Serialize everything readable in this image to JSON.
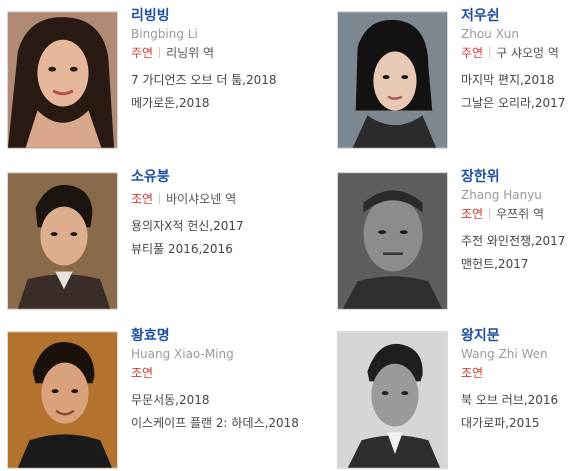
{
  "actors": [
    {
      "name": "리빙빙",
      "en_name": "Bingbing Li",
      "role": "주연",
      "character": "리닝위 역",
      "works": [
        "7 가디언즈 오브 더 툼,2018",
        "메가로돈,2018"
      ]
    },
    {
      "name": "저우쉰",
      "en_name": "Zhou Xun",
      "role": "주연",
      "character": "구 샤오멍 역",
      "works": [
        "마지막 편지,2018",
        "그날은 오리라,2017"
      ]
    },
    {
      "name": "소유붕",
      "en_name": "",
      "role": "조연",
      "character": "바이샤오넨 역",
      "works": [
        "용의자X적 헌신,2017",
        "뷰티풀 2016,2016"
      ]
    },
    {
      "name": "장한위",
      "en_name": "Zhang Hanyu",
      "role": "조연",
      "character": "우쯔쥐 역",
      "works": [
        "주전 와인전쟁,2017",
        "맨헌트,2017"
      ]
    },
    {
      "name": "황효명",
      "en_name": "Huang Xiao-Ming",
      "role": "조연",
      "character": "",
      "works": [
        "무문서동,2018",
        "이스케이프 플랜 2: 하데스,2018"
      ]
    },
    {
      "name": "왕지문",
      "en_name": "Wang Zhi Wen",
      "role": "조연",
      "character": "",
      "works": [
        "북 오브 러브,2016",
        "대가로파,2015"
      ]
    }
  ]
}
